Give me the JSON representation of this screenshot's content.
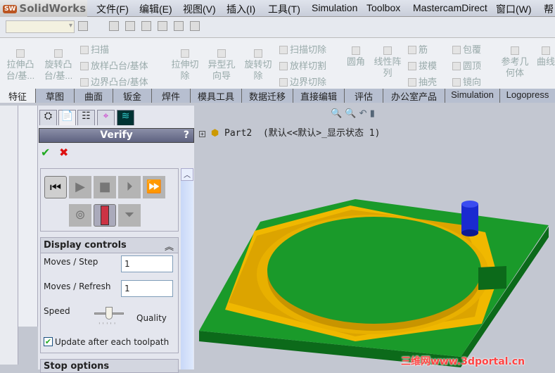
{
  "app": {
    "logo": "SolidWorks"
  },
  "menu": [
    "文件(F)",
    "编辑(E)",
    "视图(V)",
    "插入(I)",
    "工具(T)",
    "Simulation",
    "Toolbox",
    "MastercamDirect",
    "窗口(W)",
    "帮助"
  ],
  "commands": {
    "big": [
      "拉伸凸台/基...",
      "旋转凸台/基...",
      "拉伸切除",
      "异型孔向导",
      "旋转切除",
      "圆角",
      "线性阵列",
      "参考几何体",
      "曲线"
    ],
    "small": [
      "扫描",
      "放样凸台/基体",
      "边界凸台/基体",
      "扫描切除",
      "放样切割",
      "边界切除",
      "筋",
      "拔模",
      "抽壳",
      "包覆",
      "圆顶",
      "镜向"
    ]
  },
  "tabs": [
    "特征",
    "草图",
    "曲面",
    "钣金",
    "焊件",
    "模具工具",
    "数据迁移",
    "直接编辑",
    "评估",
    "办公室产品",
    "Simulation",
    "Logopress"
  ],
  "panel": {
    "title": "Verify",
    "help": "?",
    "display_controls": {
      "title": "Display controls",
      "moves_step_label": "Moves / Step",
      "moves_step": "1",
      "moves_refresh_label": "Moves / Refresh",
      "moves_refresh": "1",
      "speed_label": "Speed",
      "quality_label": "Quality",
      "speed_quality": 0.5,
      "update_label": "Update after each toolpath",
      "update_checked": true
    },
    "stop_options": {
      "title": "Stop options"
    }
  },
  "tree": {
    "part": "Part2",
    "config": "(默认<<默认>_显示状态 1)"
  },
  "watermark": "三维网www.3dportal.cn",
  "colors": {
    "plate": "#1a9a2a",
    "pocket": "#f0b800",
    "tool": "#1a2ad0"
  }
}
